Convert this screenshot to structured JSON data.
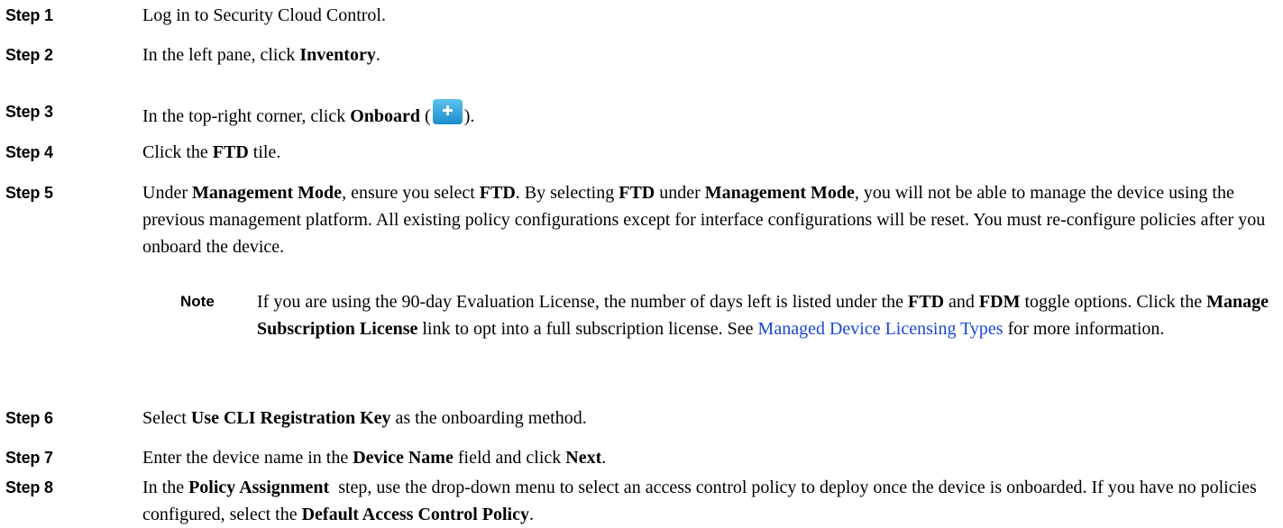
{
  "steps": [
    {
      "label": "Step 1",
      "parts": [
        "Log in to Security Cloud Control."
      ]
    },
    {
      "label": "Step 2",
      "parts": [
        "In the left pane, click ",
        "Inventory",
        "."
      ]
    },
    {
      "label": "Step 3",
      "parts": [
        "In the top-right corner, click ",
        "Onboard",
        " (",
        ")."
      ]
    },
    {
      "label": "Step 4",
      "parts": [
        "Click the ",
        "FTD",
        " tile."
      ]
    },
    {
      "label": "Step 5",
      "parts": [
        "Under ",
        "Management Mode",
        ", ensure you select ",
        "FTD",
        ". By selecting ",
        "FTD",
        " under ",
        "Management Mode",
        ", you will not be able to manage the device using the previous management platform. All existing policy configurations except for interface configurations will be reset. You must re-configure policies after you onboard the device."
      ]
    },
    {
      "label": "Step 6",
      "parts": [
        "Select ",
        "Use CLI Registration Key",
        " as the onboarding method."
      ]
    },
    {
      "label": "Step 7",
      "parts": [
        "Enter the device name in the ",
        "Device Name",
        " field and click ",
        "Next",
        "."
      ]
    },
    {
      "label": "Step 8",
      "parts": [
        "In the ",
        "Policy Assignment",
        "  step, use the drop-down menu to select an access control policy to deploy once the device is onboarded. If you have no policies configured, select the ",
        "Default Access Control Policy",
        "."
      ]
    }
  ],
  "note": {
    "label": "Note",
    "parts": [
      "If you are using the 90-day Evaluation License, the number of days left is listed under the ",
      "FTD",
      " and ",
      "FDM",
      " toggle options. Click the ",
      "Manage Subscription License",
      " link to opt into a full subscription license. See ",
      "Managed Device Licensing Types",
      " for more information."
    ]
  },
  "icons": {
    "onboard": "plus-icon",
    "onboard_color": "#2aa4dc"
  }
}
